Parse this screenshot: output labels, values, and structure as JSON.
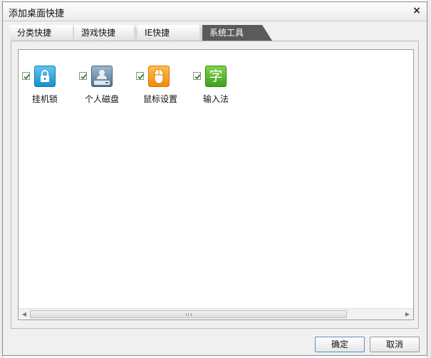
{
  "dialog": {
    "title": "添加桌面快捷",
    "close": "×"
  },
  "tabs": [
    {
      "label": "分类快捷",
      "active": false
    },
    {
      "label": "游戏快捷",
      "active": false
    },
    {
      "label": "IE快捷",
      "active": false
    },
    {
      "label": "系统工具",
      "active": true
    }
  ],
  "items": [
    {
      "label": "挂机锁",
      "icon": "lock-icon",
      "checked": true
    },
    {
      "label": "个人磁盘",
      "icon": "disk-icon",
      "checked": true
    },
    {
      "label": "鼠标设置",
      "icon": "mouse-icon",
      "checked": true
    },
    {
      "label": "输入法",
      "icon": "ime-icon",
      "glyph": "字",
      "checked": true
    }
  ],
  "buttons": {
    "ok": "确定",
    "cancel": "取消"
  },
  "colors": {
    "active_tab": "#5b5b5b",
    "check": "#2a8a2a"
  }
}
